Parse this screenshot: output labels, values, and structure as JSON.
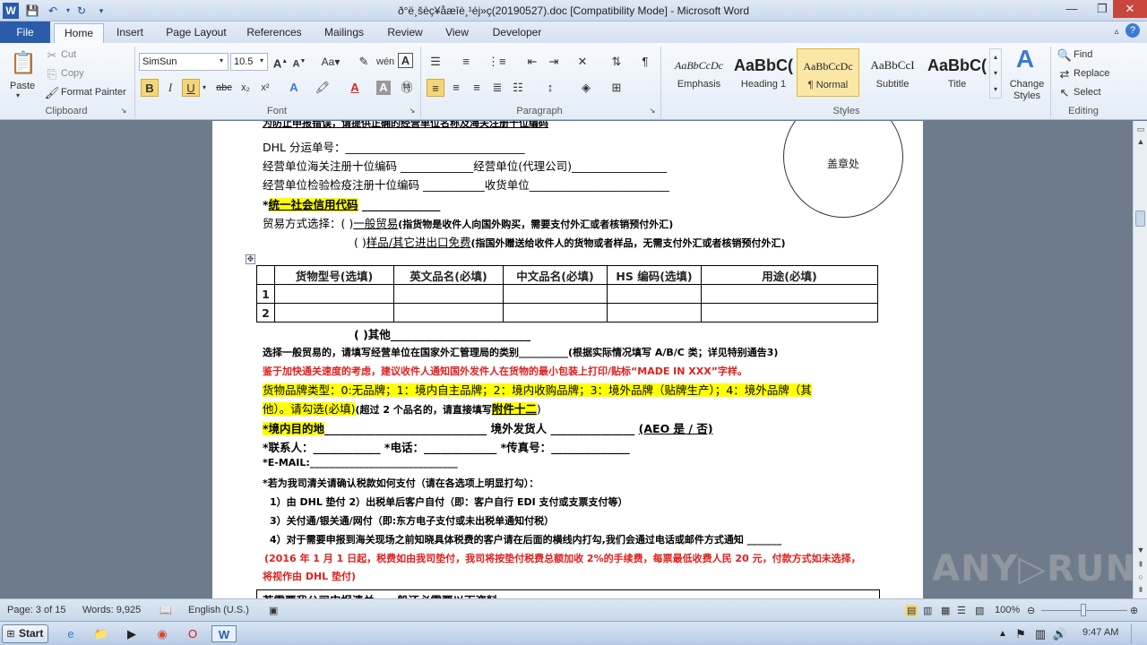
{
  "window": {
    "title": "ð°ë¸šèç¥åæîè¸¹éj»ç(20190527).doc [Compatibility Mode]  -  Microsoft Word",
    "qat_icons": [
      "word-app-icon",
      "save-icon",
      "undo-icon",
      "redo-icon",
      "customize-icon"
    ]
  },
  "tabs": [
    "File",
    "Home",
    "Insert",
    "Page Layout",
    "References",
    "Mailings",
    "Review",
    "View",
    "Developer"
  ],
  "ribbon": {
    "clipboard": {
      "paste": "Paste",
      "cut": "Cut",
      "copy": "Copy",
      "format_painter": "Format Painter",
      "label": "Clipboard"
    },
    "font": {
      "name": "SimSun",
      "size": "10.5",
      "label": "Font",
      "bold": "B",
      "italic": "I",
      "underline": "U",
      "strike": "abc",
      "sub": "x₂",
      "sup": "x²"
    },
    "paragraph": {
      "label": "Paragraph"
    },
    "styles": {
      "label": "Styles",
      "items": [
        {
          "sample": "AaBbCcDc",
          "name": "Emphasis"
        },
        {
          "sample": "AaBbC(",
          "name": "Heading 1"
        },
        {
          "sample": "AaBbCcDc",
          "name": "¶ Normal"
        },
        {
          "sample": "AaBbCcI",
          "name": "Subtitle"
        },
        {
          "sample": "AaBbC(",
          "name": "Title"
        }
      ],
      "change_styles": "Change Styles"
    },
    "editing": {
      "find": "Find",
      "replace": "Replace",
      "select": "Select",
      "label": "Editing"
    }
  },
  "document": {
    "line0": "为防止申报错误，请提供正确的经营单位名称及海关注册十位编码",
    "dhl_no": "DHL 分运单号：",
    "line2a": "经营单位海关注册十位编码",
    "line2b": "经营单位(代理公司)",
    "line3a": "经营单位检验检疫注册十位编码",
    "line3b": "收货单位",
    "credit_code": "统一社会信用代码",
    "trade_mode": "贸易方式选择：(",
    "general_trade": "一般贸易",
    "general_trade_note": "(指货物是收件人向国外购买，需要支付外汇或者核销预付外汇)",
    "sample_trade": "样品/其它进出口免费",
    "sample_trade_note": "(指国外赠送给收件人的货物或者样品，无需支付外汇或者核销预付外汇)",
    "stamp": "盖章处",
    "table": {
      "headers": [
        "货物型号(选填)",
        "英文品名(必填)",
        "中文品名(必填)",
        "HS 编码(选填)",
        "用途(必填)"
      ],
      "rows": [
        "1",
        "2"
      ]
    },
    "other": "(      )其他",
    "line_select": "选择一般贸易的，请填写经营单位在国家外汇管理局的类别",
    "line_select_note": "(根据实际情况填写 A/B/C 类；详见特别通告3)",
    "red1": "鉴于加快通关速度的考虑，建议收件人通知国外发件人在货物的最小包装上打印/贴标“MADE IN XXX”字样。",
    "brand_line1": "货物品牌类型：0:无品牌；1：境内自主品牌；2：境内收购品牌；3：境外品牌（贴牌生产）；4：境外品牌（其",
    "brand_line2": "他）。请勾选(必填)",
    "brand_note": "(超过 2 个品名的，请直接填写",
    "brand_attach": "附件十二",
    "brand_close": ")",
    "dest": "*境内目的地",
    "shipper": "境外发货人",
    "aeo": "(AEO 是  /  否)",
    "contact": "*联系人：",
    "phone": "*电话：",
    "fax": "*传真号：",
    "email": "*E-MAIL:",
    "tax_q": "*若为我司清关请确认税款如何支付（请在各选项上明显打勾）：",
    "opt1": "1）由 DHL 垫付    2）出税单后客户自付（即：客户自行 EDI 支付或支票支付等）",
    "opt2": "3）关付通/银关通/网付（即:东方电子支付或未出税单通知付税）",
    "opt4": "4）对于需要申报到海关现场之前知晓具体税费的客户请在后面的横线内打勾,我们会通过电话或邮件方式通知",
    "red2a": "(2016 年 1 月 1 日起，税费如由我司垫付，我司将按垫付税费总额加收 2%的手续费，每票最低收费人民 20 元，付款方式如未选择，",
    "red2b": "将视作由 DHL 垫付)",
    "last": "若需要我公司申报清关，一般还必需要以下资料"
  },
  "status": {
    "page": "Page: 3 of 15",
    "words": "Words: 9,925",
    "language": "English (U.S.)",
    "zoom": "100%"
  },
  "taskbar": {
    "start": "Start",
    "time": "9:47 AM"
  },
  "watermark": "ANY▷RUN"
}
